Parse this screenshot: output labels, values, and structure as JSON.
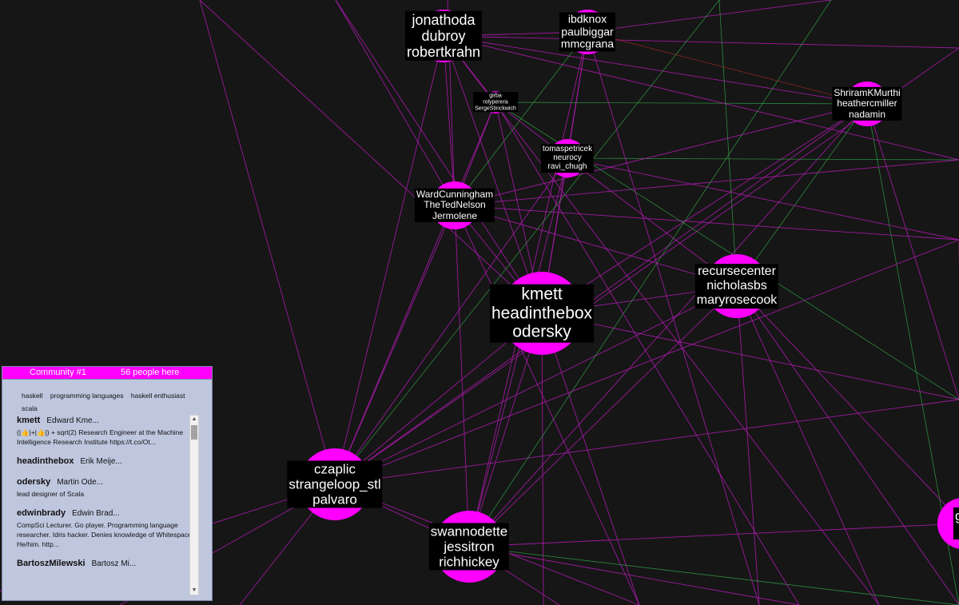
{
  "colors": {
    "background": "#161616",
    "node": "#ff00ff",
    "edge_magenta": "#b31ab3",
    "edge_green": "#33b04a",
    "edge_red": "#b02a2a",
    "panel_bg": "#bfc7df",
    "panel_header": "#ff00ff"
  },
  "graph": {
    "nodes": [
      {
        "id": "n1",
        "lines": [
          "jonathoda",
          "dubroy",
          "robertkrahn"
        ],
        "size": "large"
      },
      {
        "id": "n2",
        "lines": [
          "ibdknox",
          "paulbiggar",
          "mmcgrana"
        ],
        "size": "medium"
      },
      {
        "id": "n3",
        "lines": [
          "girba",
          "rolyperera",
          "SergeStinckwich"
        ],
        "size": "tiny"
      },
      {
        "id": "n4",
        "lines": [
          "ShriramKMurthi",
          "heathercmiller",
          "nadamin"
        ],
        "size": "medium"
      },
      {
        "id": "n5",
        "lines": [
          "tomaspetricek",
          "neurocy",
          "ravi_chugh"
        ],
        "size": "small"
      },
      {
        "id": "n6",
        "lines": [
          "WardCunningham",
          "TheTedNelson",
          "Jermolene"
        ],
        "size": "medium"
      },
      {
        "id": "n7",
        "lines": [
          "kmett",
          "headinthebox",
          "odersky"
        ],
        "size": "xlarge"
      },
      {
        "id": "n8",
        "lines": [
          "recursecenter",
          "nicholasbs",
          "maryrosecook"
        ],
        "size": "large"
      },
      {
        "id": "n9",
        "lines": [
          "czaplic",
          "strangeloop_stl",
          "palvaro"
        ],
        "size": "large"
      },
      {
        "id": "n10",
        "lines": [
          "swannodette",
          "jessitron",
          "richhickey"
        ],
        "size": "large"
      },
      {
        "id": "n11",
        "lines": [
          "gar",
          ""
        ],
        "size": "large"
      }
    ]
  },
  "panel": {
    "title": "Community #1",
    "count": "56 people here",
    "tags": [
      "haskell",
      "programming languages",
      "haskell enthusiast",
      "scala"
    ],
    "people": [
      {
        "handle": "kmett",
        "name": "Edward Kme...",
        "bio": "(|👍|+|👍|) + sqrt(2) Research Engineer at the Machine Intelligence Research Institute https://t.co/Ot..."
      },
      {
        "handle": "headinthebox",
        "name": "Erik Meije...",
        "bio": ""
      },
      {
        "handle": "odersky",
        "name": "Martin Ode...",
        "bio": "lead designer of Scala"
      },
      {
        "handle": "edwinbrady",
        "name": "Edwin Brad...",
        "bio": "CompSci Lecturer. Go player. Programming language researcher. Idris hacker. Denies knowledge of Whitespace. He/him. http..."
      },
      {
        "handle": "BartoszMilewski",
        "name": "Bartosz Mi...",
        "bio": ""
      }
    ]
  }
}
